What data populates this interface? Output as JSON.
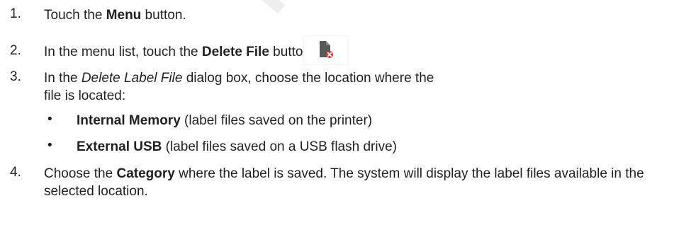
{
  "watermark": "INE",
  "steps": [
    {
      "num": "1.",
      "pre": "Touch the ",
      "bold": "Menu",
      "post": " button."
    },
    {
      "num": "2.",
      "pre": "In the menu list, touch the ",
      "bold": "Delete File",
      "post": " button.",
      "icon": "delete-file-icon"
    },
    {
      "num": "3.",
      "pre": "In the ",
      "italic": "Delete Label File",
      "post": " dialog box, choose the location where the file is located:"
    },
    {
      "num": "4.",
      "pre": "Choose the ",
      "bold": "Category",
      "post": " where the label is saved. The system will display the label files available in the selected location."
    }
  ],
  "bullets": [
    {
      "marker": "•",
      "bold": "Internal Memory",
      "post": " (label files saved on the printer)"
    },
    {
      "marker": "•",
      "bold": "External USB",
      "post": " (label files saved on a USB flash drive)"
    }
  ],
  "colors": {
    "text": "#231f20",
    "icon_file": "#595959",
    "icon_badge": "#d9352f"
  }
}
